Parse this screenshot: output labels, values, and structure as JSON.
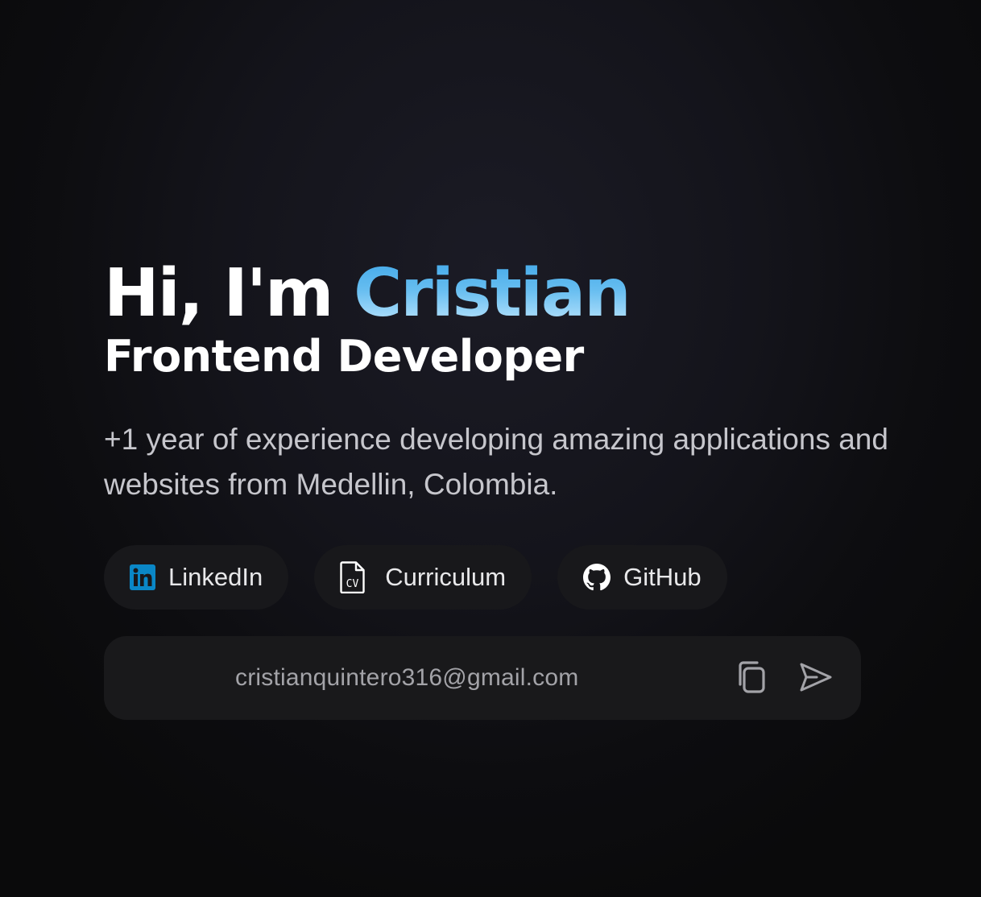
{
  "hero": {
    "greeting": "Hi, I'm",
    "name": "Cristian",
    "role": "Frontend Developer",
    "bio": "+1 year of experience developing amazing applications and websites from Medellin, Colombia."
  },
  "socials": [
    {
      "label": "LinkedIn",
      "icon": "linkedin-icon",
      "color": "#0a87c7"
    },
    {
      "label": "Curriculum",
      "icon": "cv-document-icon",
      "color": "#ffffff"
    },
    {
      "label": "GitHub",
      "icon": "github-icon",
      "color": "#ffffff"
    }
  ],
  "contact": {
    "email": "cristianquintero316@gmail.com",
    "copy_icon": "copy-icon",
    "send_icon": "send-icon"
  },
  "colors": {
    "accent_gradient_start": "#3ea6e8",
    "accent_gradient_end": "#c9ebff",
    "background": "#0d0d10",
    "pill_background": "#18181b"
  }
}
